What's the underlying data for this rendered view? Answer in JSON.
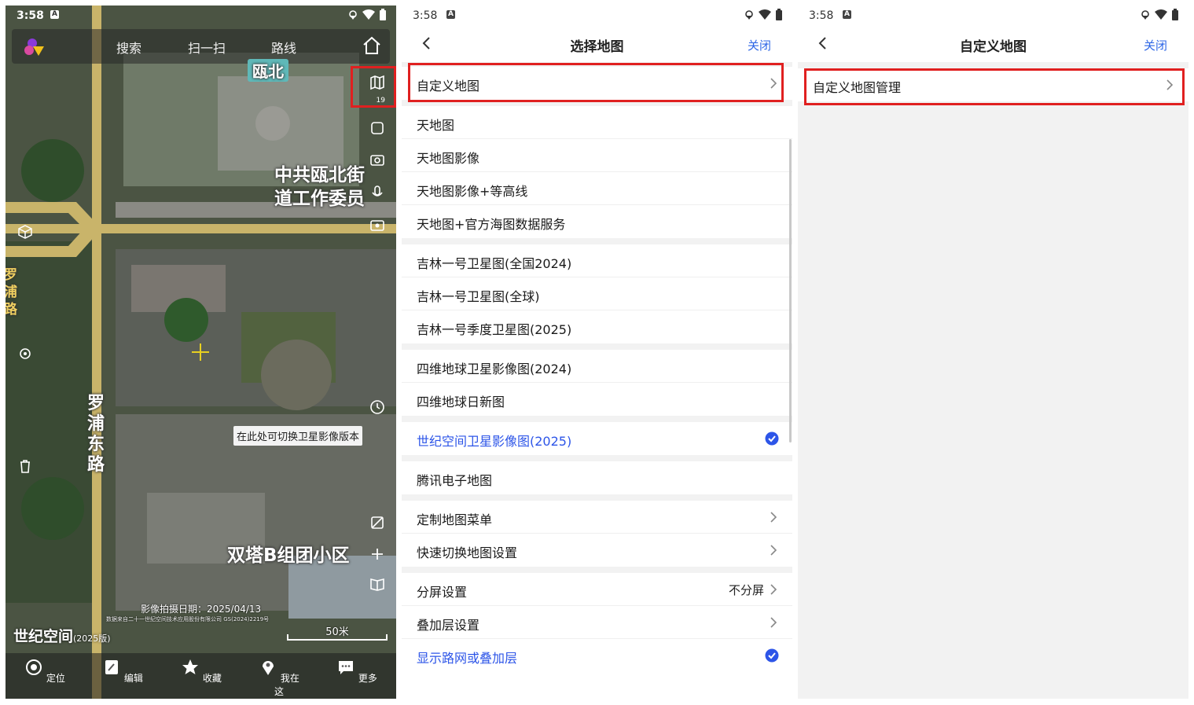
{
  "status": {
    "time": "3:58",
    "a_glyph": "A"
  },
  "map_panel": {
    "toolbar": {
      "search": "搜索",
      "scan": "扫一扫",
      "route": "路线"
    },
    "layer_badge": "19",
    "labels": {
      "district": "瓯北",
      "committee_line1": "中共瓯北街",
      "committee_line2": "道工作委员",
      "road_v1": "罗",
      "road_v2": "浦",
      "road_v3": "东",
      "road_v4": "路",
      "road_left": "罗浦路",
      "community": "双塔B组团小区"
    },
    "tooltip": "在此处可切换卫星影像版本",
    "capture_date": "影像拍摄日期：2025/04/13",
    "copyright": "数据来自二十一世纪空间技术应用股份有限公司 GS(2024)2219号",
    "brand": "世纪空间",
    "brand_year": "(2025版)",
    "scale": "50米",
    "bottom_nav": [
      "定位",
      "编辑",
      "收藏",
      "我在这",
      "更多"
    ]
  },
  "select_panel": {
    "title": "选择地图",
    "close": "关闭",
    "groups": [
      [
        {
          "label": "自定义地图",
          "chevron": true,
          "highlight": true
        }
      ],
      [
        {
          "label": "天地图"
        },
        {
          "label": "天地图影像"
        },
        {
          "label": "天地图影像+等高线"
        },
        {
          "label": "天地图+官方海图数据服务"
        }
      ],
      [
        {
          "label": "吉林一号卫星图(全国2024)"
        },
        {
          "label": "吉林一号卫星图(全球)"
        },
        {
          "label": "吉林一号季度卫星图(2025)"
        }
      ],
      [
        {
          "label": "四维地球卫星影像图(2024)"
        },
        {
          "label": "四维地球日新图"
        }
      ],
      [
        {
          "label": "世纪空间卫星影像图(2025)",
          "selected": true
        }
      ],
      [
        {
          "label": "腾讯电子地图"
        }
      ],
      [
        {
          "label": "定制地图菜单",
          "chevron": true
        },
        {
          "label": "快速切换地图设置",
          "chevron": true
        }
      ],
      [
        {
          "label": "分屏设置",
          "value": "不分屏",
          "chevron": true
        },
        {
          "label": "叠加层设置",
          "chevron": true
        },
        {
          "label": "显示路网或叠加层",
          "selected": true
        }
      ]
    ]
  },
  "custom_panel": {
    "title": "自定义地图",
    "close": "关闭",
    "items": [
      {
        "label": "自定义地图管理"
      }
    ]
  },
  "colors": {
    "accent": "#2d55e8",
    "highlight_border": "#e02020",
    "road": "#c9b46a"
  }
}
